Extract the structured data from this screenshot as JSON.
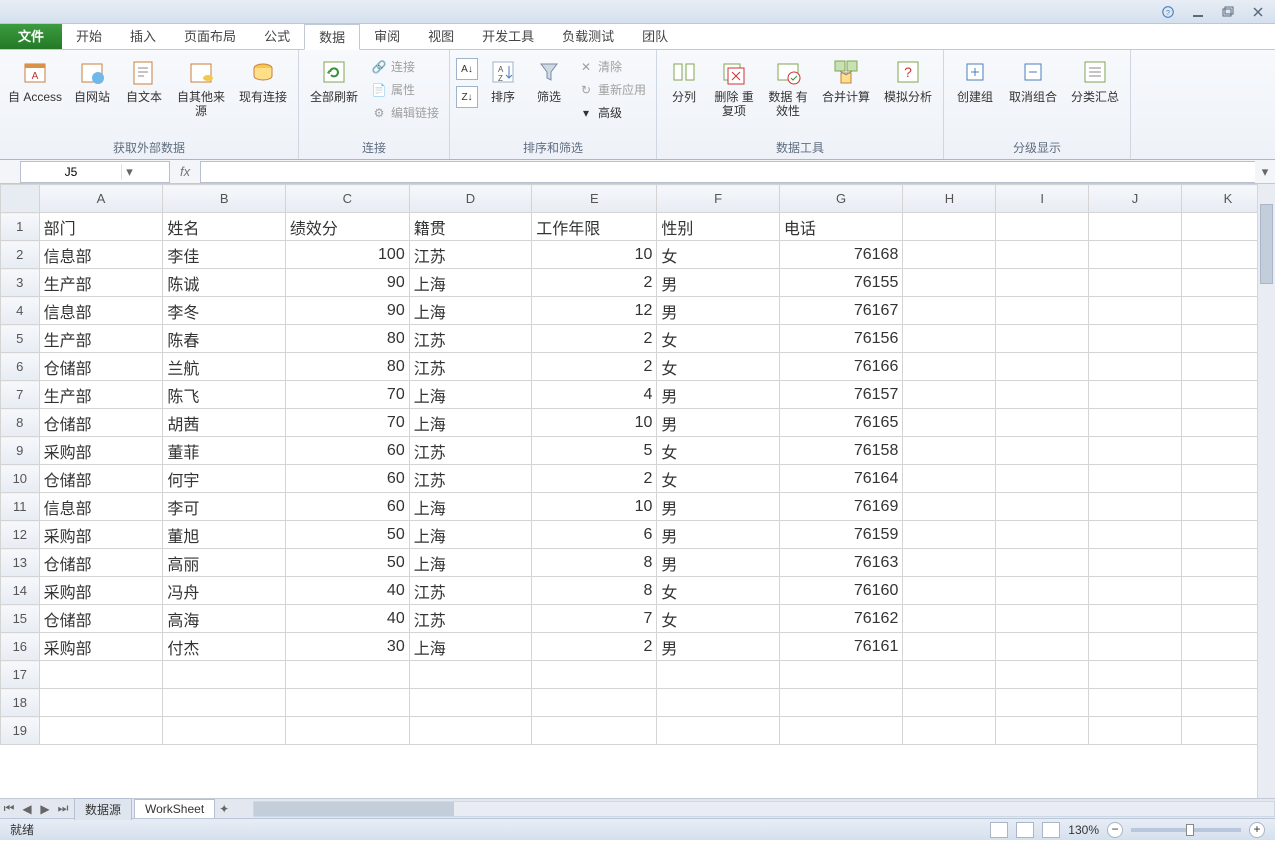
{
  "window": {
    "help_icon": "?",
    "min": "—",
    "max": "▭",
    "close": "✕"
  },
  "tabs": {
    "file": "文件",
    "home": "开始",
    "insert": "插入",
    "pagelayout": "页面布局",
    "formulas": "公式",
    "data": "数据",
    "review": "审阅",
    "view": "视图",
    "dev": "开发工具",
    "loadtest": "负载测试",
    "team": "团队"
  },
  "ribbon": {
    "ext": {
      "access": "自 Access",
      "web": "自网站",
      "text": "自文本",
      "other": "自其他来源",
      "existing": "现有连接",
      "title": "获取外部数据"
    },
    "conn": {
      "refresh": "全部刷新",
      "connections": "连接",
      "properties": "属性",
      "editlinks": "编辑链接",
      "title": "连接"
    },
    "sort": {
      "az": "A↓Z",
      "za": "Z↓A",
      "sort": "排序",
      "filter": "筛选",
      "clear": "清除",
      "reapply": "重新应用",
      "advanced": "高级",
      "title": "排序和筛选"
    },
    "tools": {
      "texttocol": "分列",
      "dedupe": "删除\n重复项",
      "validate": "数据\n有效性",
      "consolidate": "合并计算",
      "whatif": "模拟分析",
      "title": "数据工具"
    },
    "outline": {
      "group": "创建组",
      "ungroup": "取消组合",
      "subtotal": "分类汇总",
      "title": "分级显示"
    }
  },
  "namebox": "J5",
  "fx": "fx",
  "columns": [
    "A",
    "B",
    "C",
    "D",
    "E",
    "F",
    "G",
    "H",
    "I",
    "J",
    "K"
  ],
  "headers": [
    "部门",
    "姓名",
    "绩效分",
    "籍贯",
    "工作年限",
    "性别",
    "电话"
  ],
  "rows": [
    [
      "信息部",
      "李佳",
      100,
      "江苏",
      10,
      "女",
      76168
    ],
    [
      "生产部",
      "陈诚",
      90,
      "上海",
      2,
      "男",
      76155
    ],
    [
      "信息部",
      "李冬",
      90,
      "上海",
      12,
      "男",
      76167
    ],
    [
      "生产部",
      "陈春",
      80,
      "江苏",
      2,
      "女",
      76156
    ],
    [
      "仓储部",
      "兰航",
      80,
      "江苏",
      2,
      "女",
      76166
    ],
    [
      "生产部",
      "陈飞",
      70,
      "上海",
      4,
      "男",
      76157
    ],
    [
      "仓储部",
      "胡茜",
      70,
      "上海",
      10,
      "男",
      76165
    ],
    [
      "采购部",
      "董菲",
      60,
      "江苏",
      5,
      "女",
      76158
    ],
    [
      "仓储部",
      "何宇",
      60,
      "江苏",
      2,
      "女",
      76164
    ],
    [
      "信息部",
      "李可",
      60,
      "上海",
      10,
      "男",
      76169
    ],
    [
      "采购部",
      "董旭",
      50,
      "上海",
      6,
      "男",
      76159
    ],
    [
      "仓储部",
      "高丽",
      50,
      "上海",
      8,
      "男",
      76163
    ],
    [
      "采购部",
      "冯舟",
      40,
      "江苏",
      8,
      "女",
      76160
    ],
    [
      "仓储部",
      "高海",
      40,
      "江苏",
      7,
      "女",
      76162
    ],
    [
      "采购部",
      "付杰",
      30,
      "上海",
      2,
      "男",
      76161
    ]
  ],
  "empty_rows": [
    17,
    18,
    19
  ],
  "sheets": {
    "s1": "数据源",
    "s2": "WorkSheet"
  },
  "status": {
    "ready": "就绪",
    "zoom": "130%"
  }
}
